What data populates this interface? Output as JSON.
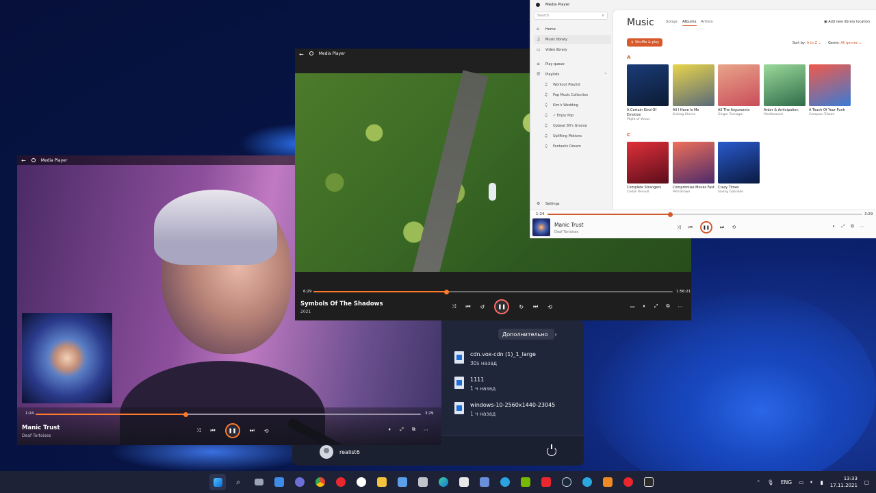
{
  "start_menu": {
    "more_label": "Дополнительно",
    "more_chevron": "›",
    "recent": [
      {
        "name": "cdn.vox-cdn (1)_1_large",
        "time": "30s назад",
        "icon": "image-file-icon"
      },
      {
        "name": "1111",
        "time": "1 ч назад",
        "icon": "image-file-icon"
      },
      {
        "name": "windows-10-2560x1440-23045",
        "time": "1 ч назад",
        "icon": "image-file-icon"
      }
    ],
    "user": "realist6"
  },
  "player1": {
    "app_title": "Media Player",
    "time_current": "1:24",
    "time_total": "3:29",
    "progress": 0.39,
    "title": "Manic Trust",
    "artist": "Deaf Tortoises"
  },
  "player2": {
    "app_title": "Media Player",
    "time_current": "6:29",
    "time_total": "1:56:21",
    "progress": 0.37,
    "title": "Symbols Of The Shadows",
    "year": "2021"
  },
  "library": {
    "app_title": "Media Player",
    "search_placeholder": "Search",
    "nav": {
      "home": "Home",
      "music_library": "Music library",
      "video_library": "Video library",
      "play_queue": "Play queue",
      "playlists": "Playlists",
      "settings": "Settings"
    },
    "playlists": [
      "Workout Playlist",
      "Pop Music Collection",
      "Kim's Wedding",
      "✓ Enjoy Pop",
      "Upbeat 80's Groove",
      "Uplifting Motions",
      "Fantastic Dream"
    ],
    "title": "Music",
    "tabs": [
      "Songs",
      "Albums",
      "Artists"
    ],
    "active_tab": "Albums",
    "add_location": "Add new library location",
    "shuffle": "Shuffle & play",
    "sort_label": "Sort by:",
    "sort_value": "A to Z",
    "genre_label": "Genre:",
    "genre_value": "All genres",
    "sections": [
      {
        "letter": "A",
        "albums": [
          {
            "title": "A Certain Kind Of Emotion",
            "artist": "Plight of Venus",
            "color_a": "#1a3c78",
            "color_b": "#0d1b33"
          },
          {
            "title": "All I Have Is Me",
            "artist": "Kicking Gloves",
            "color_a": "#e8d44a",
            "color_b": "#5a6a7a"
          },
          {
            "title": "All The Arguments",
            "artist": "Ginger Teenager",
            "color_a": "#e9a58a",
            "color_b": "#c94c5a"
          },
          {
            "title": "Ardor & Anticipation",
            "artist": "Pointbeaxed",
            "color_a": "#9bd99a",
            "color_b": "#2f6c4a"
          },
          {
            "title": "A Touch Of Your Punk",
            "artist": "Compass Tribute",
            "color_a": "#f05a4a",
            "color_b": "#3a7bd5"
          }
        ]
      },
      {
        "letter": "C",
        "albums": [
          {
            "title": "Complete Strangers",
            "artist": "Corbin Revival",
            "color_a": "#e0303a",
            "color_b": "#5a0d1a"
          },
          {
            "title": "Compromise Moves Fast",
            "artist": "Pete Brown",
            "color_a": "#f0705a",
            "color_b": "#4a2a6a"
          },
          {
            "title": "Crazy Times",
            "artist": "Saving Gabrielle",
            "color_a": "#2a5acd",
            "color_b": "#0a1a40"
          }
        ]
      }
    ],
    "bar": {
      "time_current": "1:24",
      "time_total": "3:29",
      "progress": 0.39,
      "title": "Manic Trust",
      "artist": "Deaf Tortoises"
    }
  },
  "tray": {
    "lang": "ENG",
    "time": "13:33",
    "date": "17.11.2021"
  },
  "accent_color": "#ff7a2a"
}
